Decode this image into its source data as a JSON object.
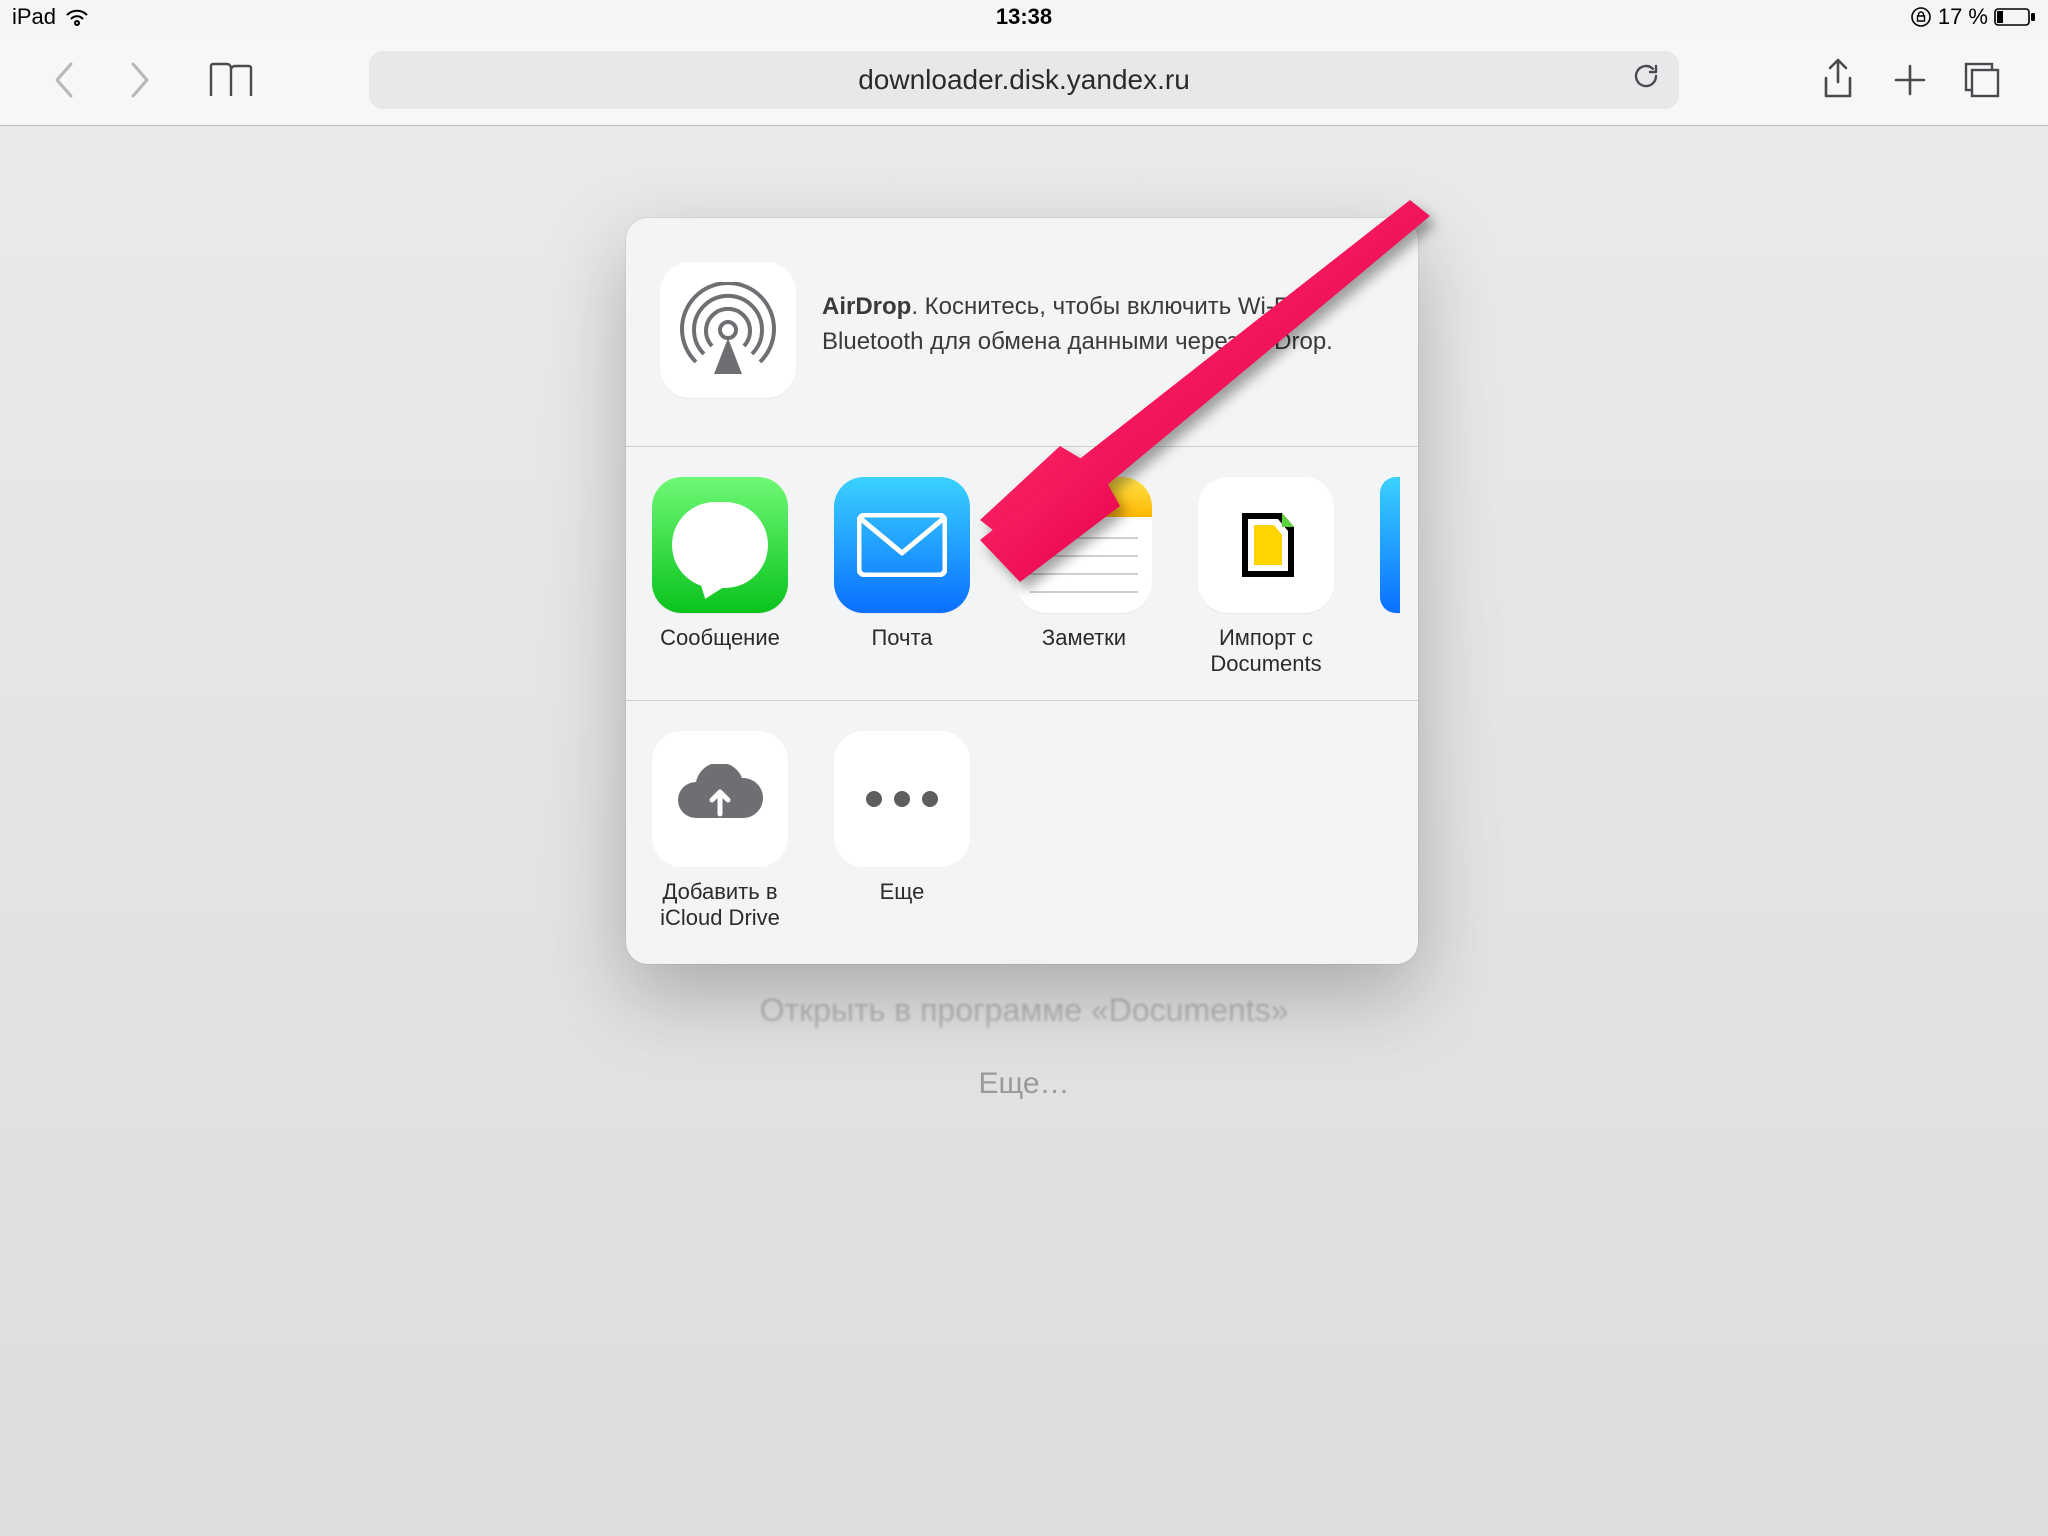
{
  "status": {
    "device": "iPad",
    "time": "13:38",
    "battery_pct": "17 %"
  },
  "toolbar": {
    "url": "downloader.disk.yandex.ru"
  },
  "behind": {
    "line1": "Открыть в программе «Documents»",
    "line2": "Еще…"
  },
  "share": {
    "airdrop": {
      "title": "AirDrop",
      "desc": ". Коснитесь, чтобы включить Wi-Fi и Bluetooth для обмена данными через AirDrop."
    },
    "apps": [
      {
        "label": "Сообщение"
      },
      {
        "label": "Почта"
      },
      {
        "label": "Заметки"
      },
      {
        "label": "Импорт с Documents"
      }
    ],
    "actions": [
      {
        "label": "Добавить в iCloud Drive"
      },
      {
        "label": "Еще"
      }
    ]
  }
}
